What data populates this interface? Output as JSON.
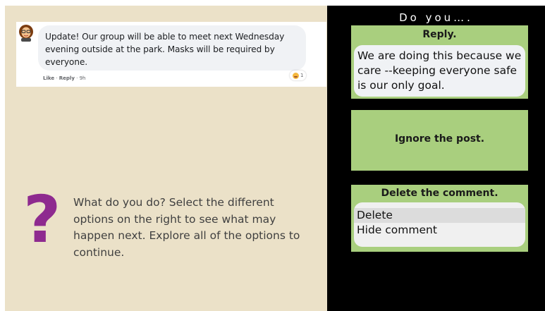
{
  "post": {
    "text": "Update!  Our group will be able to meet next Wednesday evening outside at the park.  Masks will be required by everyone.",
    "reaction_count": "1",
    "actions": {
      "like": "Like",
      "separator": " · ",
      "reply": "Reply",
      "time": "9h"
    }
  },
  "prompt": {
    "symbol": "?",
    "text": "What do you do? Select the different options on the right to see what may happen next. Explore all of the options to continue."
  },
  "choices": {
    "title": "Do you….",
    "reply": {
      "label": "Reply.",
      "response": "We are doing this because we care --keeping everyone safe is our only goal."
    },
    "ignore": {
      "label": "Ignore the post."
    },
    "delete": {
      "label": "Delete the comment.",
      "menu": [
        "Delete",
        "Hide comment"
      ]
    }
  },
  "colors": {
    "left_bg": "#ebe1c8",
    "right_bg": "#000000",
    "option_green": "#a9cf7e",
    "question_mark": "#8e2a8f"
  }
}
